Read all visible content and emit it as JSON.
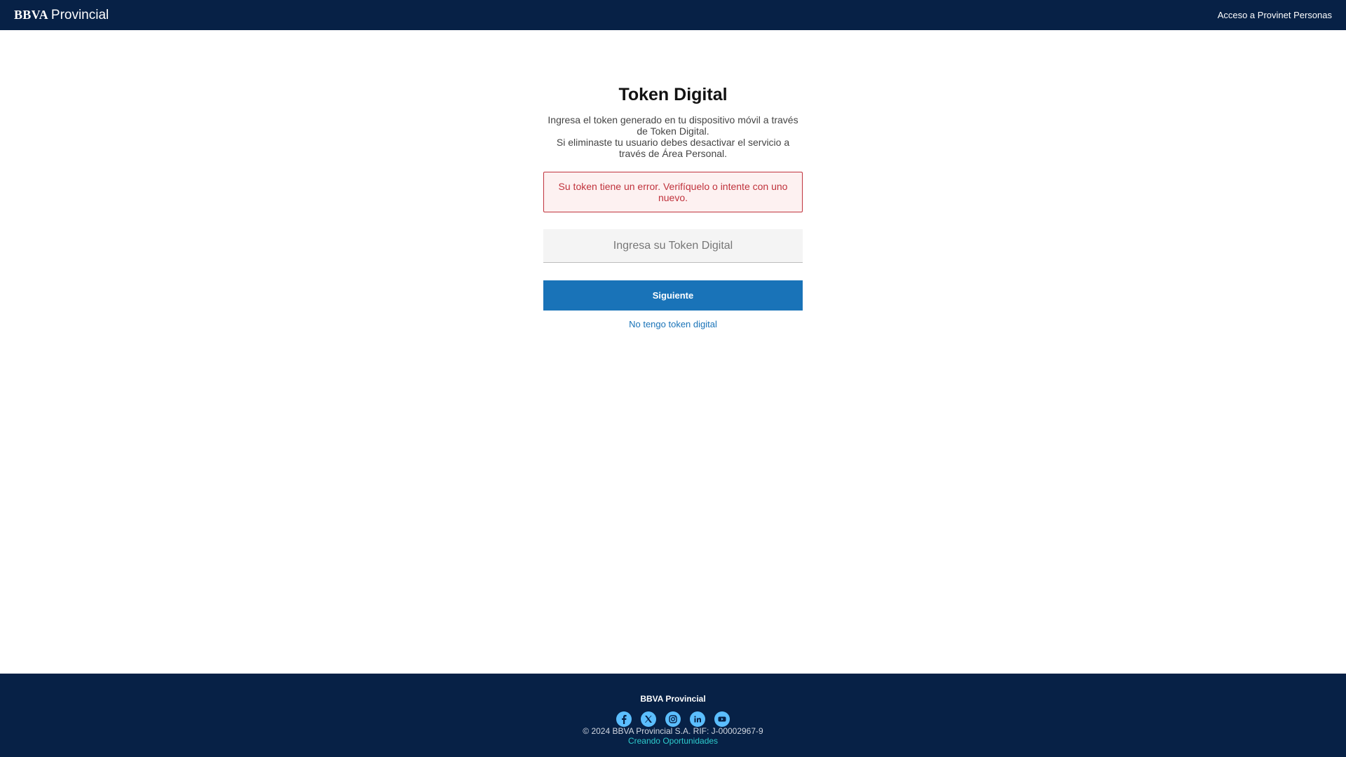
{
  "header": {
    "brand_bold": "BBVA",
    "brand_light": "Provincial",
    "access_link": "Acceso a Provinet Personas"
  },
  "main": {
    "title": "Token Digital",
    "description_line1": "Ingresa el token generado en tu dispositivo móvil a través de Token Digital.",
    "description_line2": "Si eliminaste tu usuario debes desactivar el servicio a través de Área Personal.",
    "error_message": "Su token tiene un error. Verifíquelo o intente con uno nuevo.",
    "token_input": {
      "value": "",
      "placeholder": "Ingresa su Token Digital"
    },
    "next_button": "Siguiente",
    "no_token_link": "No tengo token digital"
  },
  "footer": {
    "brand": "BBVA Provincial",
    "socials": [
      "facebook-icon",
      "x-twitter-icon",
      "instagram-icon",
      "linkedin-icon",
      "youtube-icon"
    ],
    "copyright": "© 2024 BBVA Provincial S.A. RIF: J-00002967-9",
    "slogan": "Creando Oportunidades"
  },
  "colors": {
    "navy": "#072146",
    "primary_blue": "#1973b8",
    "error_red": "#c0323c",
    "social_blue": "#5bbeff",
    "aqua": "#2dcccd"
  }
}
